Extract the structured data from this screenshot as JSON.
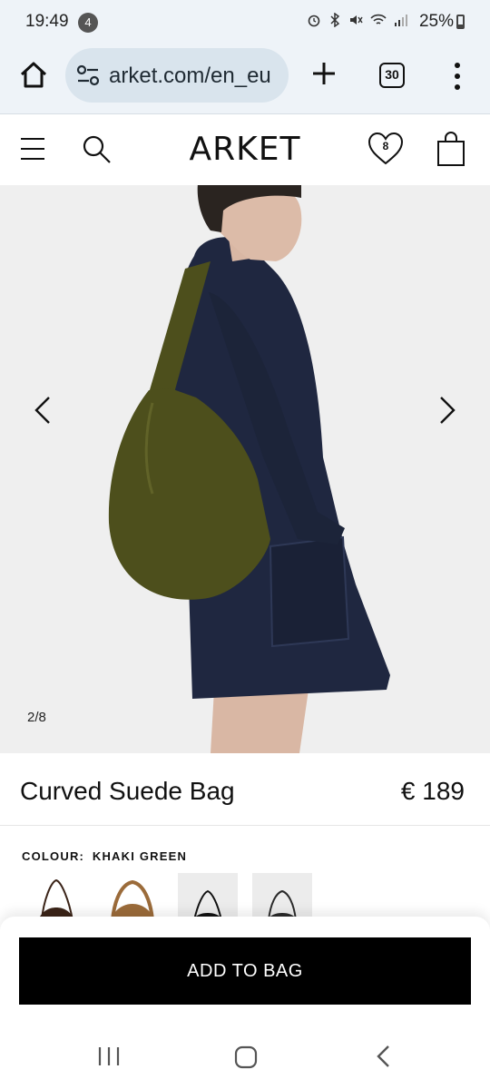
{
  "status_bar": {
    "time": "19:49",
    "notification_count": "4",
    "battery": "25%"
  },
  "browser": {
    "url": "arket.com/en_eu",
    "tab_count": "30"
  },
  "header": {
    "brand": "ARKET",
    "wishlist_count": "8"
  },
  "gallery": {
    "counter": "2/8"
  },
  "product": {
    "name": "Curved Suede Bag",
    "price": "€ 189",
    "colour_label": "COLOUR:",
    "colour_value": "KHAKI GREEN",
    "swatches": [
      {
        "name": "dark-brown",
        "color": "#3b2418"
      },
      {
        "name": "tan",
        "color": "#9b6b3a"
      },
      {
        "name": "black",
        "color": "#111111"
      },
      {
        "name": "dark-grey",
        "color": "#2a2a2a"
      }
    ]
  },
  "actions": {
    "add_to_bag": "ADD TO BAG"
  },
  "colors": {
    "bag_khaki": "#4d4f1c",
    "denim": "#1f2740",
    "browser_bg": "#eef3f8"
  }
}
